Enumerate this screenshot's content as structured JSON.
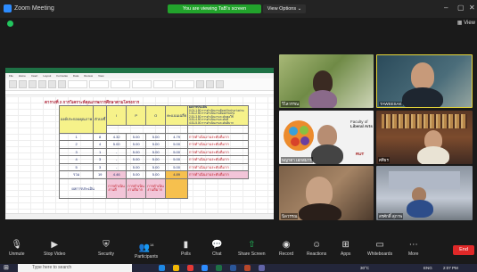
{
  "title_bar": {
    "app_name": "Zoom Meeting",
    "share_banner": "You are viewing TaB's screen",
    "view_options": "View Options",
    "view_label": "View"
  },
  "spreadsheet": {
    "title": "ตารางที่ 2 การวิเคราะห์คุณภาพการศึกษาตามโครงการ",
    "header": [
      "องค์ประกอบคุณภาพ",
      "ตัวบ่งชี้",
      "I",
      "P",
      "O",
      "คะแนนเฉลี่ย",
      "ผลการประเมิน"
    ],
    "criteria": [
      "0.01-1.50 การดำเนินงานต้องปรับปรุงเร่งด่วน",
      "1.51-2.50 การดำเนินงานต้องปรับปรุง",
      "2.51-3.50 การดำเนินงานระดับพอใช้",
      "3.51-4.50 การดำเนินงานระดับดี",
      "4.51-5.00 การดำเนินงานระดับดีมาก"
    ],
    "rows": [
      {
        "c1": "1",
        "c2": "8",
        "c3": "4.32",
        "c4": "5.00",
        "c5": "5.00",
        "c6": "4.79",
        "c7": "การดำเนินงานระดับดีมาก"
      },
      {
        "c1": "2",
        "c2": "4",
        "c3": "5.00",
        "c4": "5.00",
        "c5": "5.00",
        "c6": "5.00",
        "c7": "การดำเนินงานระดับดีมาก"
      },
      {
        "c1": "3",
        "c2": "1",
        "c3": "-",
        "c4": "5.00",
        "c5": "5.00",
        "c6": "5.00",
        "c7": "การดำเนินงานระดับดีมาก"
      },
      {
        "c1": "4",
        "c2": "3",
        "c3": "-",
        "c4": "5.00",
        "c5": "5.00",
        "c6": "5.00",
        "c7": "การดำเนินงานระดับดีมาก"
      },
      {
        "c1": "5",
        "c2": "3",
        "c3": "-",
        "c4": "5.00",
        "c5": "5.00",
        "c6": "5.00",
        "c7": "การดำเนินงานระดับดีมาก"
      }
    ],
    "total": {
      "label": "รวม",
      "count": "19",
      "i": "4.46",
      "p": "5.00",
      "o": "5.00",
      "avg": "4.89",
      "result": "การดำเนินงานระดับดีมาก"
    },
    "footer_label": "ผลการประเมิน",
    "footer_cells": [
      "การดำเนินงานดี",
      "การดำเนินงานดีมาก",
      "การดำเนินงานดีมาก"
    ]
  },
  "participants": [
    {
      "name": "วิไลวรรณ"
    },
    {
      "name": "TAWEESAK"
    },
    {
      "name": "พญาดา เอกสมาร"
    },
    {
      "name": "ศศิธร"
    },
    {
      "name": "นิลวรรณ"
    },
    {
      "name": "สรศักดิ์ สุภาพ"
    }
  ],
  "sharer_logo": {
    "line1": "Faculty of",
    "line2": "Liberal Arts",
    "brand": "RUT"
  },
  "toolbar": {
    "unmute": "Unmute",
    "stop_video": "Stop Video",
    "security": "Security",
    "participants": "Participants",
    "participants_count": "14",
    "polls": "Polls",
    "chat": "Chat",
    "share_screen": "Share Screen",
    "record": "Record",
    "reactions": "Reactions",
    "apps": "Apps",
    "whiteboards": "Whiteboards",
    "more": "More",
    "end": "End"
  },
  "taskbar": {
    "search_placeholder": "Type here to search",
    "weather": "30°C",
    "language": "ENG",
    "time": "2:07 PM"
  },
  "colors": {
    "share_green": "#22a32c",
    "end_red": "#e02828",
    "highlight_yellow": "#f6f28a"
  }
}
